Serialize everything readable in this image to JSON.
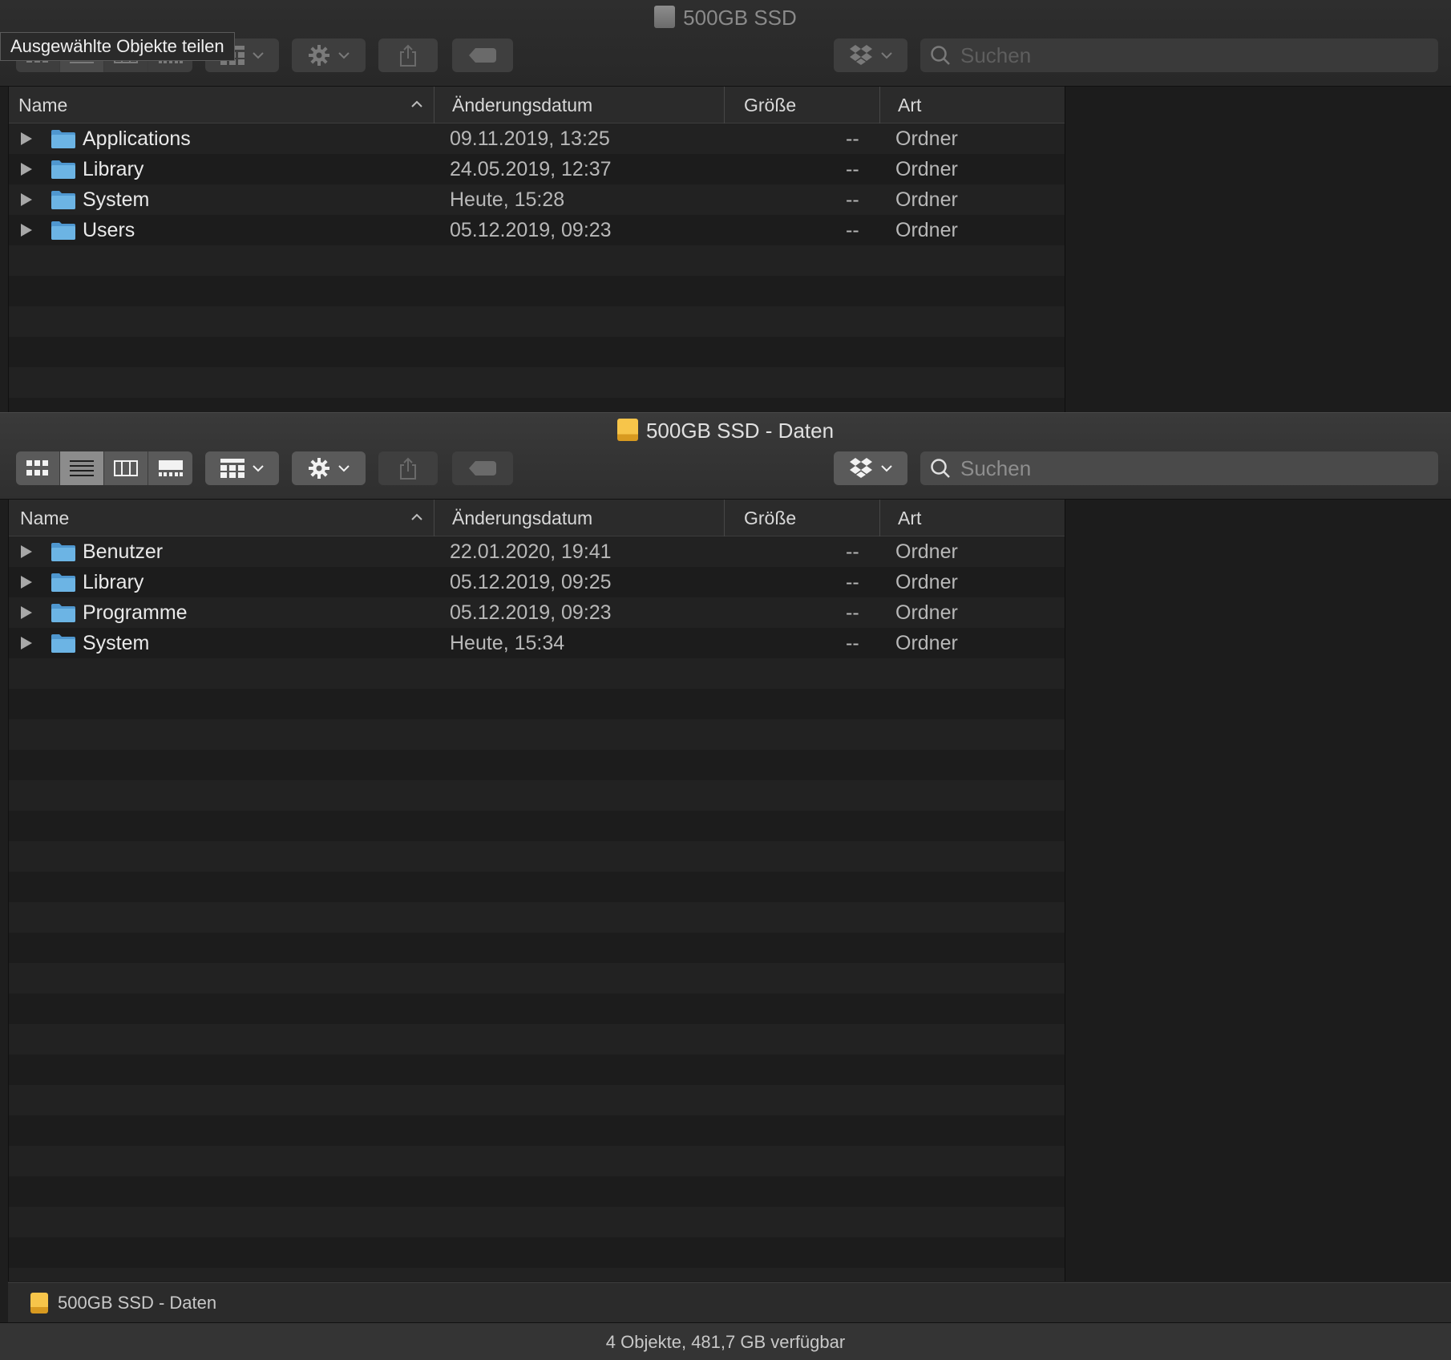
{
  "tooltip": "Ausgewählte Objekte teilen",
  "top_window": {
    "title": "500GB SSD",
    "search_placeholder": "Suchen",
    "columns": {
      "name": "Name",
      "date": "Änderungsdatum",
      "size": "Größe",
      "kind": "Art"
    },
    "rows": [
      {
        "name": "Applications",
        "date": "09.11.2019, 13:25",
        "size": "--",
        "kind": "Ordner"
      },
      {
        "name": "Library",
        "date": "24.05.2019, 12:37",
        "size": "--",
        "kind": "Ordner"
      },
      {
        "name": "System",
        "date": "Heute, 15:28",
        "size": "--",
        "kind": "Ordner"
      },
      {
        "name": "Users",
        "date": "05.12.2019, 09:23",
        "size": "--",
        "kind": "Ordner"
      }
    ]
  },
  "bottom_window": {
    "title": "500GB SSD - Daten",
    "search_placeholder": "Suchen",
    "columns": {
      "name": "Name",
      "date": "Änderungsdatum",
      "size": "Größe",
      "kind": "Art"
    },
    "rows": [
      {
        "name": "Benutzer",
        "date": "22.01.2020, 19:41",
        "size": "--",
        "kind": "Ordner"
      },
      {
        "name": "Library",
        "date": "05.12.2019, 09:25",
        "size": "--",
        "kind": "Ordner"
      },
      {
        "name": "Programme",
        "date": "05.12.2019, 09:23",
        "size": "--",
        "kind": "Ordner"
      },
      {
        "name": "System",
        "date": "Heute, 15:34",
        "size": "--",
        "kind": "Ordner"
      }
    ],
    "path_bar": "500GB SSD - Daten",
    "status": "4 Objekte, 481,7 GB verfügbar"
  },
  "icons": {
    "view_modes": [
      "icon-view-icon",
      "list-view-icon",
      "column-view-icon",
      "gallery-view-icon"
    ],
    "group": "group-grid-icon",
    "action": "gear-icon",
    "share": "share-icon",
    "tag": "tag-icon",
    "dropbox": "dropbox-icon",
    "search": "search-icon",
    "folder": "folder-icon",
    "disclosure": "disclosure-triangle-icon"
  },
  "colors": {
    "folder_blue": "#6cb4e4",
    "disk_orange": "#f0b43c",
    "background": "#1e1e1e"
  }
}
